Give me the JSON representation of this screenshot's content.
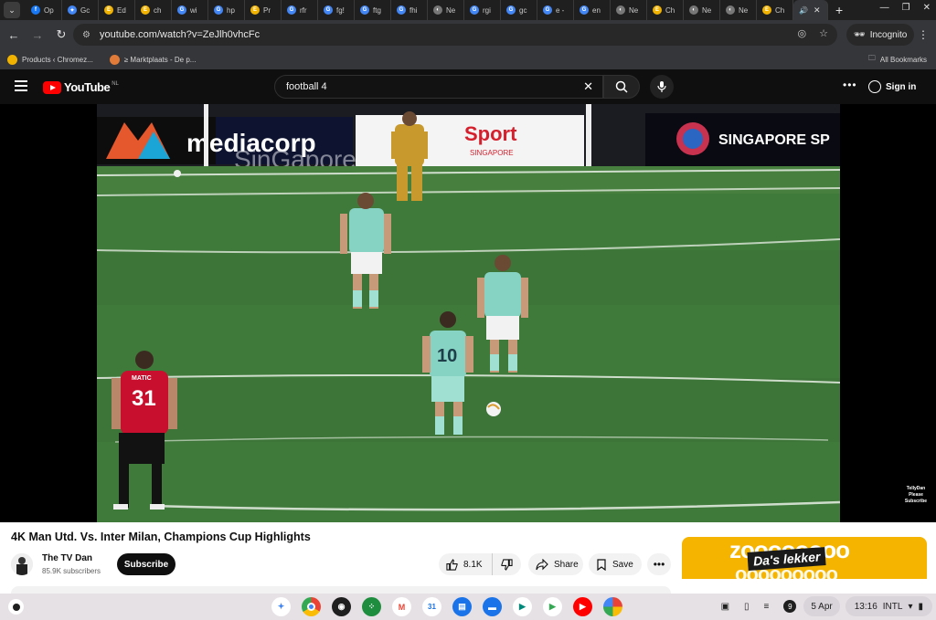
{
  "browser": {
    "tabs": [
      {
        "label": "Op",
        "color": "#1877f2",
        "glyph": "f"
      },
      {
        "label": "Gc",
        "color": "#4285f4",
        "glyph": "✦"
      },
      {
        "label": "Ed",
        "color": "#f2b300",
        "glyph": "E"
      },
      {
        "label": "ch",
        "color": "#f2b300",
        "glyph": "E"
      },
      {
        "label": "wi",
        "color": "#4285f4",
        "glyph": "G"
      },
      {
        "label": "hp",
        "color": "#4285f4",
        "glyph": "G"
      },
      {
        "label": "Pr",
        "color": "#f2b300",
        "glyph": "E"
      },
      {
        "label": "rfr",
        "color": "#4285f4",
        "glyph": "G"
      },
      {
        "label": "fg!",
        "color": "#4285f4",
        "glyph": "G"
      },
      {
        "label": "ftg",
        "color": "#4285f4",
        "glyph": "G"
      },
      {
        "label": "fhi",
        "color": "#4285f4",
        "glyph": "G"
      },
      {
        "label": "Ne",
        "color": "#777777",
        "glyph": "◐"
      },
      {
        "label": "rgi",
        "color": "#4285f4",
        "glyph": "G"
      },
      {
        "label": "gc",
        "color": "#4285f4",
        "glyph": "G"
      },
      {
        "label": "e -",
        "color": "#4285f4",
        "glyph": "G"
      },
      {
        "label": "en",
        "color": "#4285f4",
        "glyph": "G"
      },
      {
        "label": "Ne",
        "color": "#777777",
        "glyph": "◐"
      },
      {
        "label": "Ch",
        "color": "#f2b300",
        "glyph": "E"
      },
      {
        "label": "Ne",
        "color": "#777777",
        "glyph": "◐"
      },
      {
        "label": "Ne",
        "color": "#777777",
        "glyph": "◐"
      },
      {
        "label": "Ch",
        "color": "#f2b300",
        "glyph": "E"
      }
    ],
    "active_tab_icon": "🔊",
    "new_tab": "+",
    "url": "youtube.com/watch?v=ZeJlh0vhcFc",
    "incognito_label": "Incognito",
    "bookmarks": [
      {
        "label": "Products ‹ Chromez..."
      },
      {
        "label": "≥ Marktplaats - De p..."
      }
    ],
    "all_bookmarks": "All Bookmarks"
  },
  "youtube": {
    "logo_text": "YouTube",
    "region": "NL",
    "search_value": "football 4",
    "sign_in": "Sign in"
  },
  "video": {
    "title": "4K Man Utd. Vs. Inter Milan, Champions Cup Highlights",
    "ad_banner_1": "mediacorp",
    "ad_banner_2": "SinGapore",
    "ad_banner_3": "Sport",
    "ad_banner_3_sub": "SINGAPORE",
    "ad_banner_4": "SINGAPORE SP",
    "player_number_1": "31",
    "player_name_1": "MATIC",
    "player_number_2": "10",
    "watermark_name": "TellyDan",
    "watermark_sub": "Please Subscribe"
  },
  "channel": {
    "name": "The TV Dan",
    "subscribers": "85.9K subscribers",
    "subscribe_label": "Subscribe"
  },
  "actions": {
    "likes": "8.1K",
    "share": "Share",
    "save": "Save"
  },
  "ad": {
    "headline": "zoooooooo",
    "tagline": "Da's lekker"
  },
  "shelf": {
    "date": "5 Apr",
    "time": "13:16",
    "keyboard": "INTL",
    "notifications": "9"
  },
  "colors": {
    "youtube_red": "#ff0000",
    "pitch_green": "#3b6e35",
    "inter_kit": "#7fd3c0",
    "united_kit": "#c8102e",
    "ad_yellow": "#f5b400"
  }
}
